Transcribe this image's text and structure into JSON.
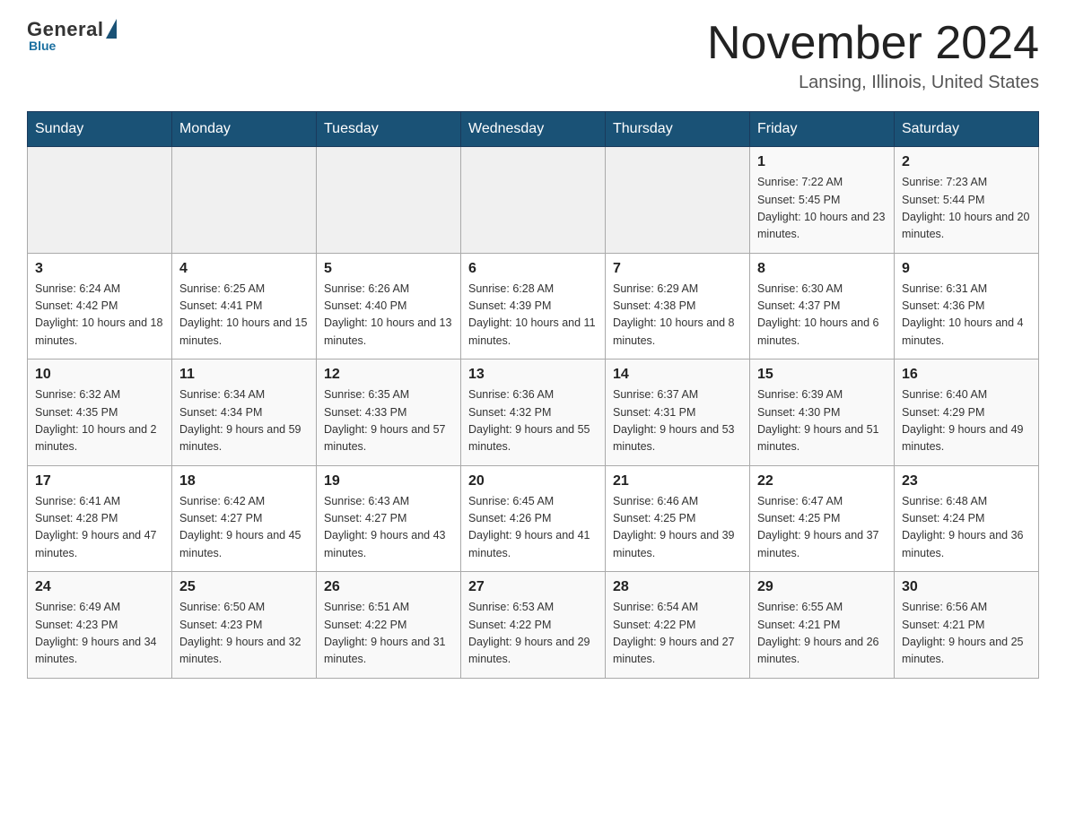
{
  "logo": {
    "general": "General",
    "blue": "Blue"
  },
  "calendar": {
    "title": "November 2024",
    "subtitle": "Lansing, Illinois, United States",
    "days_of_week": [
      "Sunday",
      "Monday",
      "Tuesday",
      "Wednesday",
      "Thursday",
      "Friday",
      "Saturday"
    ],
    "weeks": [
      [
        {
          "day": "",
          "info": ""
        },
        {
          "day": "",
          "info": ""
        },
        {
          "day": "",
          "info": ""
        },
        {
          "day": "",
          "info": ""
        },
        {
          "day": "",
          "info": ""
        },
        {
          "day": "1",
          "info": "Sunrise: 7:22 AM\nSunset: 5:45 PM\nDaylight: 10 hours and 23 minutes."
        },
        {
          "day": "2",
          "info": "Sunrise: 7:23 AM\nSunset: 5:44 PM\nDaylight: 10 hours and 20 minutes."
        }
      ],
      [
        {
          "day": "3",
          "info": "Sunrise: 6:24 AM\nSunset: 4:42 PM\nDaylight: 10 hours and 18 minutes."
        },
        {
          "day": "4",
          "info": "Sunrise: 6:25 AM\nSunset: 4:41 PM\nDaylight: 10 hours and 15 minutes."
        },
        {
          "day": "5",
          "info": "Sunrise: 6:26 AM\nSunset: 4:40 PM\nDaylight: 10 hours and 13 minutes."
        },
        {
          "day": "6",
          "info": "Sunrise: 6:28 AM\nSunset: 4:39 PM\nDaylight: 10 hours and 11 minutes."
        },
        {
          "day": "7",
          "info": "Sunrise: 6:29 AM\nSunset: 4:38 PM\nDaylight: 10 hours and 8 minutes."
        },
        {
          "day": "8",
          "info": "Sunrise: 6:30 AM\nSunset: 4:37 PM\nDaylight: 10 hours and 6 minutes."
        },
        {
          "day": "9",
          "info": "Sunrise: 6:31 AM\nSunset: 4:36 PM\nDaylight: 10 hours and 4 minutes."
        }
      ],
      [
        {
          "day": "10",
          "info": "Sunrise: 6:32 AM\nSunset: 4:35 PM\nDaylight: 10 hours and 2 minutes."
        },
        {
          "day": "11",
          "info": "Sunrise: 6:34 AM\nSunset: 4:34 PM\nDaylight: 9 hours and 59 minutes."
        },
        {
          "day": "12",
          "info": "Sunrise: 6:35 AM\nSunset: 4:33 PM\nDaylight: 9 hours and 57 minutes."
        },
        {
          "day": "13",
          "info": "Sunrise: 6:36 AM\nSunset: 4:32 PM\nDaylight: 9 hours and 55 minutes."
        },
        {
          "day": "14",
          "info": "Sunrise: 6:37 AM\nSunset: 4:31 PM\nDaylight: 9 hours and 53 minutes."
        },
        {
          "day": "15",
          "info": "Sunrise: 6:39 AM\nSunset: 4:30 PM\nDaylight: 9 hours and 51 minutes."
        },
        {
          "day": "16",
          "info": "Sunrise: 6:40 AM\nSunset: 4:29 PM\nDaylight: 9 hours and 49 minutes."
        }
      ],
      [
        {
          "day": "17",
          "info": "Sunrise: 6:41 AM\nSunset: 4:28 PM\nDaylight: 9 hours and 47 minutes."
        },
        {
          "day": "18",
          "info": "Sunrise: 6:42 AM\nSunset: 4:27 PM\nDaylight: 9 hours and 45 minutes."
        },
        {
          "day": "19",
          "info": "Sunrise: 6:43 AM\nSunset: 4:27 PM\nDaylight: 9 hours and 43 minutes."
        },
        {
          "day": "20",
          "info": "Sunrise: 6:45 AM\nSunset: 4:26 PM\nDaylight: 9 hours and 41 minutes."
        },
        {
          "day": "21",
          "info": "Sunrise: 6:46 AM\nSunset: 4:25 PM\nDaylight: 9 hours and 39 minutes."
        },
        {
          "day": "22",
          "info": "Sunrise: 6:47 AM\nSunset: 4:25 PM\nDaylight: 9 hours and 37 minutes."
        },
        {
          "day": "23",
          "info": "Sunrise: 6:48 AM\nSunset: 4:24 PM\nDaylight: 9 hours and 36 minutes."
        }
      ],
      [
        {
          "day": "24",
          "info": "Sunrise: 6:49 AM\nSunset: 4:23 PM\nDaylight: 9 hours and 34 minutes."
        },
        {
          "day": "25",
          "info": "Sunrise: 6:50 AM\nSunset: 4:23 PM\nDaylight: 9 hours and 32 minutes."
        },
        {
          "day": "26",
          "info": "Sunrise: 6:51 AM\nSunset: 4:22 PM\nDaylight: 9 hours and 31 minutes."
        },
        {
          "day": "27",
          "info": "Sunrise: 6:53 AM\nSunset: 4:22 PM\nDaylight: 9 hours and 29 minutes."
        },
        {
          "day": "28",
          "info": "Sunrise: 6:54 AM\nSunset: 4:22 PM\nDaylight: 9 hours and 27 minutes."
        },
        {
          "day": "29",
          "info": "Sunrise: 6:55 AM\nSunset: 4:21 PM\nDaylight: 9 hours and 26 minutes."
        },
        {
          "day": "30",
          "info": "Sunrise: 6:56 AM\nSunset: 4:21 PM\nDaylight: 9 hours and 25 minutes."
        }
      ]
    ]
  }
}
